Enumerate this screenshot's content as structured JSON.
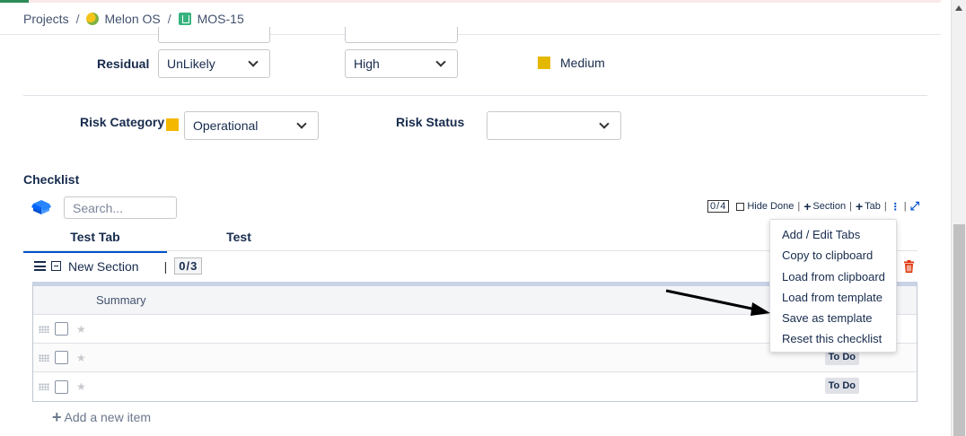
{
  "breadcrumb": {
    "projects": "Projects",
    "project": "Melon OS",
    "issue": "MOS-15",
    "separator": "/"
  },
  "residual": {
    "label": "Residual",
    "likelihood": "UnLikely",
    "impact": "High",
    "rating": "Medium",
    "rating_color": "#e5b800"
  },
  "risk": {
    "category_label": "Risk Category",
    "category_value": "Operational",
    "category_color": "#f5b800",
    "status_label": "Risk Status",
    "status_value": ""
  },
  "checklist": {
    "title": "Checklist",
    "search_placeholder": "Search...",
    "toolbar": {
      "count": "0/4",
      "hide_done": "Hide Done",
      "section": "Section",
      "tab": "Tab"
    },
    "tabs": [
      {
        "label": "Test Tab",
        "active": true
      },
      {
        "label": "Test",
        "active": false
      }
    ],
    "section": {
      "name": "New Section",
      "count": "0/3"
    },
    "table": {
      "header": "Summary",
      "rows": [
        {
          "status": ""
        },
        {
          "status": "To Do"
        },
        {
          "status": "To Do"
        }
      ]
    },
    "add_item": "Add a new item"
  },
  "menu": {
    "items": [
      "Add / Edit Tabs",
      "Copy to clipboard",
      "Load from clipboard",
      "Load from template",
      "Save as template",
      "Reset this checklist"
    ]
  },
  "colors": {
    "accent": "#0052cc",
    "delete": "#de350b"
  }
}
